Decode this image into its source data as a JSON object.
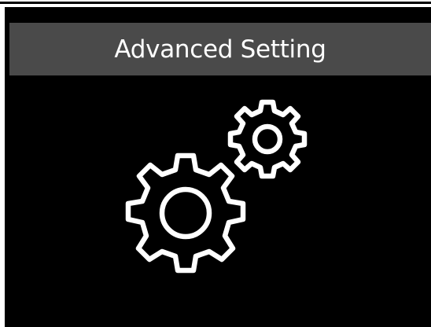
{
  "screen": {
    "title": "Advanced Setting",
    "icon": "gears-icon",
    "colors": {
      "background": "#000000",
      "title_bar": "#4a4a4a",
      "text": "#ffffff",
      "icon_stroke": "#ffffff"
    }
  }
}
